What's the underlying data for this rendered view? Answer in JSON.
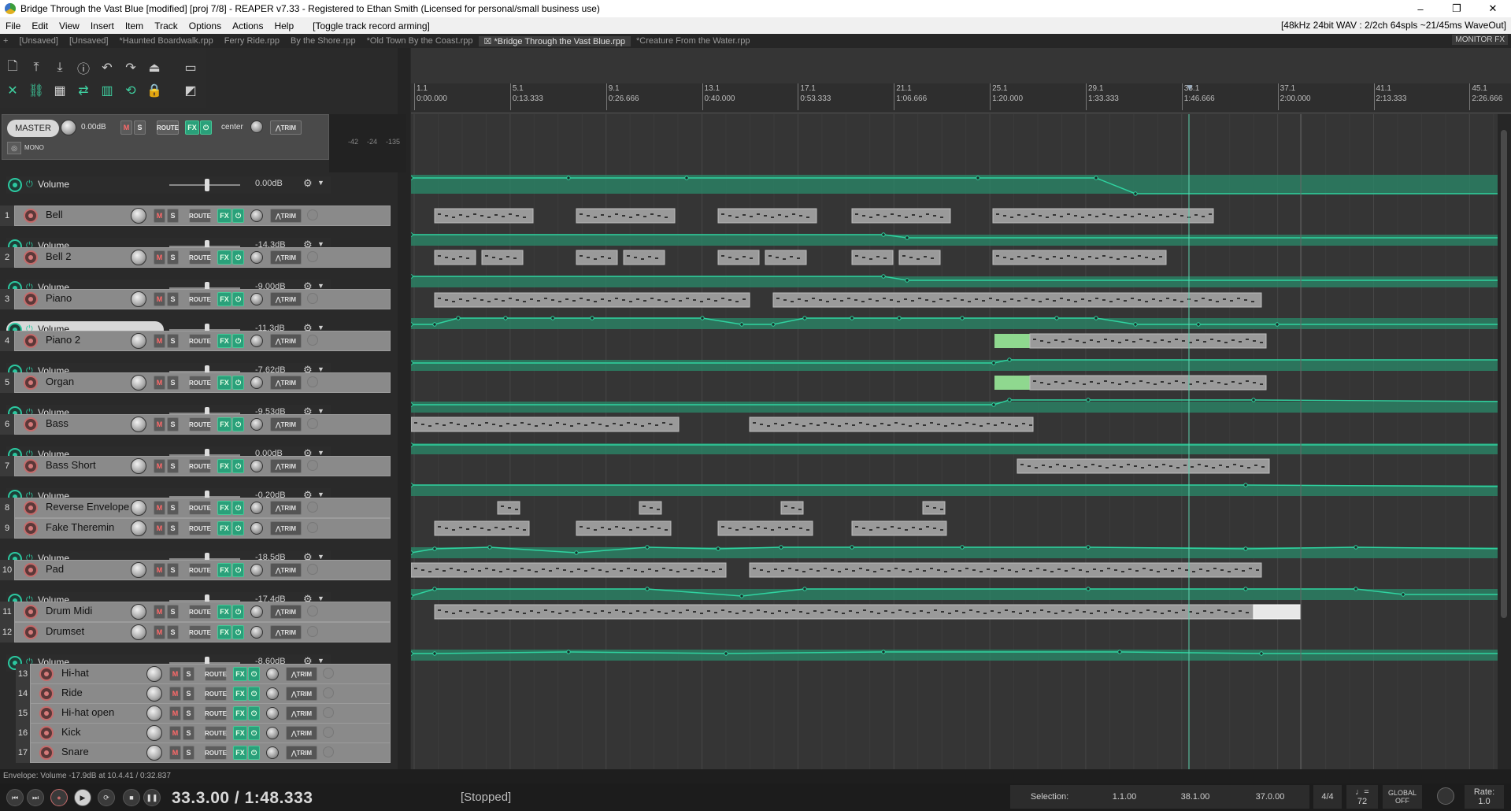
{
  "window": {
    "title": "Bridge Through the Vast Blue [modified] [proj 7/8] - REAPER v7.33 - Registered to Ethan Smith (Licensed for personal/small business use)",
    "minimize": "–",
    "maximize": "❐",
    "close": "✕"
  },
  "menubar": {
    "items": [
      "File",
      "Edit",
      "View",
      "Insert",
      "Item",
      "Track",
      "Options",
      "Actions",
      "Help"
    ],
    "toggle_action": "[Toggle track record arming]",
    "audio_status": "[48kHz 24bit WAV : 2/2ch 64spls ~21/45ms WaveOut]"
  },
  "tabs": [
    "[Unsaved]",
    "[Unsaved]",
    "*Haunted Boardwalk.rpp",
    "Ferry Ride.rpp",
    "By the Shore.rpp",
    "*Old  Town By the Coast.rpp",
    "*Bridge Through the Vast Blue.rpp",
    "*Creature From the Water.rpp"
  ],
  "active_tab_index": 6,
  "monitor_fx": "MONITOR FX",
  "master": {
    "name": "MASTER",
    "volume": "0.00dB",
    "pan": "center",
    "mono": "MONO",
    "meter_labels": [
      "-42",
      "-24",
      "-135"
    ],
    "env_label": "Volume",
    "env_value": "0.00dB"
  },
  "button_labels": {
    "m": "M",
    "s": "S",
    "route": "ROUTE",
    "fx": "FX",
    "trim": "TRIM"
  },
  "tracks": [
    {
      "num": "1",
      "name": "Bell",
      "env": "Volume",
      "env_value": "-14.3dB"
    },
    {
      "num": "2",
      "name": "Bell 2",
      "env": "Volume",
      "env_value": "-9.00dB"
    },
    {
      "num": "3",
      "name": "Piano",
      "env": "Volume",
      "env_value": "-11.3dB"
    },
    {
      "num": "4",
      "name": "Piano 2",
      "env": "Volume",
      "env_value": "-7.62dB"
    },
    {
      "num": "5",
      "name": "Organ",
      "env": "Volume",
      "env_value": "-9.53dB"
    },
    {
      "num": "6",
      "name": "Bass",
      "env": "Volume",
      "env_value": "0.00dB"
    },
    {
      "num": "7",
      "name": "Bass Short",
      "env": "Volume",
      "env_value": "-0.20dB"
    },
    {
      "num": "8",
      "name": "Reverse Envelope"
    },
    {
      "num": "9",
      "name": "Fake Theremin",
      "env": "Volume",
      "env_value": "-18.5dB"
    },
    {
      "num": "10",
      "name": "Pad",
      "env": "Volume",
      "env_value": "-17.4dB"
    },
    {
      "num": "11",
      "name": "Drum Midi"
    },
    {
      "num": "12",
      "name": "Drumset",
      "env": "Volume",
      "env_value": "-8.60dB"
    },
    {
      "num": "13",
      "name": "Hi-hat"
    },
    {
      "num": "14",
      "name": "Ride"
    },
    {
      "num": "15",
      "name": "Hi-hat open"
    },
    {
      "num": "16",
      "name": "Kick"
    },
    {
      "num": "17",
      "name": "Snare"
    }
  ],
  "ruler": [
    {
      "bar": "1.1",
      "time": "0:00.000"
    },
    {
      "bar": "5.1",
      "time": "0:13.333"
    },
    {
      "bar": "9.1",
      "time": "0:26.666"
    },
    {
      "bar": "13.1",
      "time": "0:40.000"
    },
    {
      "bar": "17.1",
      "time": "0:53.333"
    },
    {
      "bar": "21.1",
      "time": "1:06.666"
    },
    {
      "bar": "25.1",
      "time": "1:20.000"
    },
    {
      "bar": "29.1",
      "time": "1:33.333"
    },
    {
      "bar": "33.1",
      "time": "1:46.666"
    },
    {
      "bar": "37.1",
      "time": "2:00.000"
    },
    {
      "bar": "41.1",
      "time": "2:13.333"
    },
    {
      "bar": "45.1",
      "time": "2:26.666"
    }
  ],
  "status_line": "Envelope: Volume -17.9dB at 10.4.41 / 0:32.837",
  "transport": {
    "position": "33.3.00 / 1:48.333",
    "state": "[Stopped]",
    "selection_label": "Selection:",
    "sel_start": "1.1.00",
    "sel_end": "38.1.00",
    "sel_length": "37.0.00",
    "timesig": "4/4",
    "bpm": "72",
    "global": "GLOBAL",
    "global_off": "OFF",
    "rate_label": "Rate:",
    "rate": "1.0"
  },
  "colors": {
    "envelope": "#2fd3a0",
    "envelope_lane": "#2a8a6a",
    "item": "#9a9a9a",
    "accent": "#2aa07a"
  }
}
